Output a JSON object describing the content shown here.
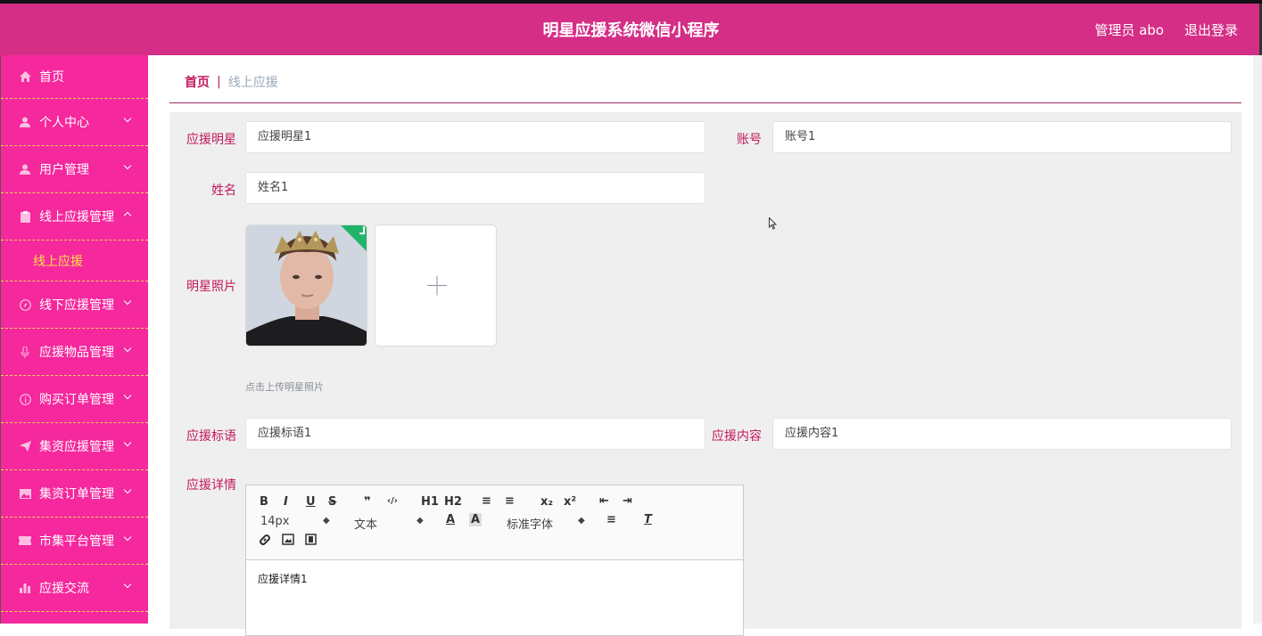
{
  "header": {
    "title": "明星应援系统微信小程序",
    "admin": "管理员 abo",
    "logout": "退出登录"
  },
  "sidebar": {
    "items": [
      {
        "label": "首页",
        "icon": "home-icon"
      },
      {
        "label": "个人中心",
        "icon": "user-icon"
      },
      {
        "label": "用户管理",
        "icon": "user-icon"
      },
      {
        "label": "线上应援管理",
        "icon": "clipboard-icon",
        "expanded": true
      },
      {
        "label": "线上应援",
        "sub": true
      },
      {
        "label": "线下应援管理",
        "icon": "compass-icon"
      },
      {
        "label": "应援物品管理",
        "icon": "microphone-icon"
      },
      {
        "label": "购买订单管理",
        "icon": "info-circle-icon"
      },
      {
        "label": "集资应援管理",
        "icon": "send-icon"
      },
      {
        "label": "集资订单管理",
        "icon": "picture-icon"
      },
      {
        "label": "市集平台管理",
        "icon": "ticket-icon"
      },
      {
        "label": "应援交流",
        "icon": "bar-chart-icon"
      }
    ]
  },
  "breadcrumb": {
    "home": "首页",
    "separator": "|",
    "current": "线上应援"
  },
  "form": {
    "star_label": "应援明星",
    "star_value": "应援明星1",
    "account_label": "账号",
    "account_value": "账号1",
    "name_label": "姓名",
    "name_value": "姓名1",
    "photo_label": "明星照片",
    "photo_hint": "点击上传明星照片",
    "slogan_label": "应援标语",
    "slogan_value": "应援标语1",
    "content_label": "应援内容",
    "content_value": "应援内容1",
    "detail_label": "应援详情"
  },
  "editor": {
    "buttons": [
      "B",
      "I",
      "U",
      "S",
      "❞",
      "‹/›",
      "H1",
      "H2",
      "≡",
      "≡",
      "x₂",
      "x²",
      "⇤",
      "⇥"
    ],
    "size": "14px",
    "header": "文本",
    "font": "标准字体",
    "content": "应援详情1"
  },
  "colors": {
    "header_bg": "#d42e86",
    "sidebar_bg": "#f5289d",
    "accent": "#c2185b",
    "active_sub": "#ffe14a"
  }
}
